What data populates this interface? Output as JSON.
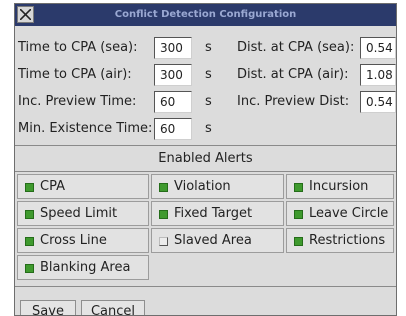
{
  "window": {
    "title": "Conflict Detection Configuration"
  },
  "parameters": [
    {
      "label": "Time to CPA (sea):",
      "value": "300",
      "unit": "s",
      "right_label": "Dist. at CPA (sea):",
      "right_value": "0.54"
    },
    {
      "label": "Time to CPA (air):",
      "value": "300",
      "unit": "s",
      "right_label": "Dist. at CPA (air):",
      "right_value": "1.08"
    },
    {
      "label": "Inc. Preview Time:",
      "value": "60",
      "unit": "s",
      "right_label": "Inc. Preview Dist:",
      "right_value": "0.54"
    },
    {
      "label": "Min. Existence Time:",
      "value": "60",
      "unit": "s"
    }
  ],
  "alerts_section": {
    "title": "Enabled Alerts"
  },
  "alerts": [
    {
      "label": "CPA",
      "checked": true
    },
    {
      "label": "Violation",
      "checked": true
    },
    {
      "label": "Incursion",
      "checked": true
    },
    {
      "label": "Speed Limit",
      "checked": true
    },
    {
      "label": "Fixed Target",
      "checked": true
    },
    {
      "label": "Leave Circle",
      "checked": true
    },
    {
      "label": "Cross Line",
      "checked": true
    },
    {
      "label": "Slaved Area",
      "checked": false
    },
    {
      "label": "Restrictions",
      "checked": true
    },
    {
      "label": "Blanking Area",
      "checked": true
    }
  ],
  "buttons": {
    "save": "Save",
    "cancel": "Cancel"
  },
  "colors": {
    "titlebar": "#2b3a6b",
    "checked": "#3f9a2e",
    "panel": "#dcdcdc"
  }
}
